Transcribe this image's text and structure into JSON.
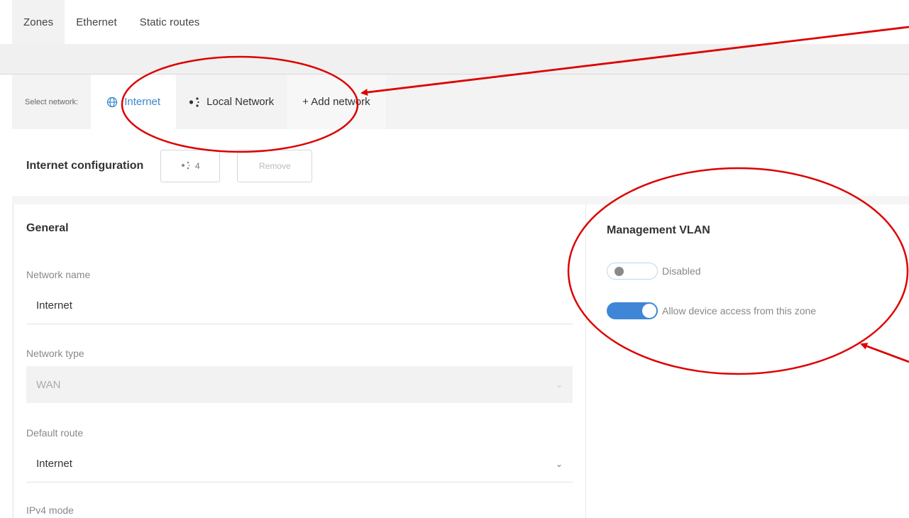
{
  "top_tabs": [
    "Zones",
    "Ethernet",
    "Static routes"
  ],
  "network": {
    "select_label": "Select network:",
    "tabs": [
      {
        "label": "Internet",
        "icon": "globe-icon",
        "active": true
      },
      {
        "label": "Local Network",
        "icon": "share-icon",
        "active": false
      },
      {
        "label": "+ Add network",
        "icon": "",
        "active": false
      }
    ]
  },
  "config": {
    "title": "Internet configuration",
    "count": "4",
    "remove_label": "Remove"
  },
  "general": {
    "title": "General",
    "network_name_label": "Network name",
    "network_name_value": "Internet",
    "network_type_label": "Network type",
    "network_type_value": "WAN",
    "default_route_label": "Default route",
    "default_route_value": "Internet",
    "ipv4_mode_label": "IPv4 mode"
  },
  "vlan": {
    "title": "Management VLAN",
    "toggle1_label": "Disabled",
    "toggle1_on": false,
    "toggle2_label": "Allow device access from this zone",
    "toggle2_on": true
  },
  "colors": {
    "accent": "#3f86d6",
    "annotation": "#dd0000"
  }
}
